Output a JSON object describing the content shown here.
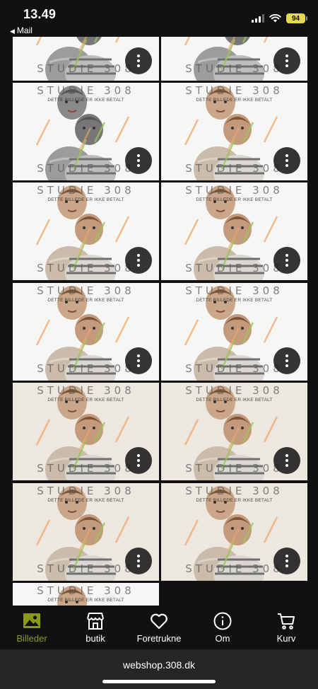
{
  "status_bar": {
    "time": "13.49",
    "back_app": "Mail",
    "battery": "94"
  },
  "photo_grid": {
    "watermark_title": "STUDIE 308",
    "watermark_subtitle": "DETTE BILLEDE ER IKKE BETALT",
    "photo_count": 13
  },
  "tab_bar": {
    "tabs": [
      {
        "label": "Billeder",
        "icon": "photos-icon",
        "active": true
      },
      {
        "label": "butik",
        "icon": "shop-icon",
        "active": false
      },
      {
        "label": "Foretrukne",
        "icon": "heart-icon",
        "active": false
      },
      {
        "label": "Om",
        "icon": "info-icon",
        "active": false
      },
      {
        "label": "Kurv",
        "icon": "cart-icon",
        "active": false
      }
    ]
  },
  "browser": {
    "url": "webshop.308.dk"
  },
  "colors": {
    "active_tab": "#8a9a18",
    "background": "#111111",
    "battery": "#e7d94d"
  }
}
